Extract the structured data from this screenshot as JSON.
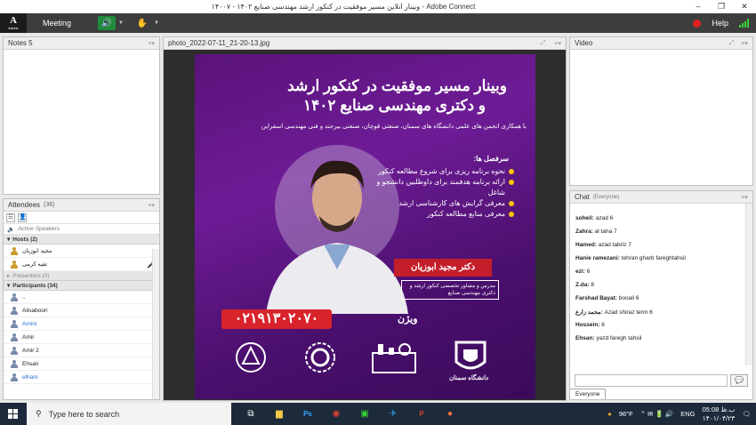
{
  "window": {
    "title": "وبینار آنلاین مسیر موفقیت در کنکور ارشد مهندسی صنایع ۱۴۰۲ - ۱۴۰۰۷ - Adobe Connect",
    "controls": [
      "–",
      "❐",
      "✕"
    ]
  },
  "menubar": {
    "logo_main": "A",
    "logo_sub": "Adobe",
    "meeting_label": "Meeting",
    "help_label": "Help",
    "colors": {
      "bg": "#3d3d3d",
      "speaker_on": "#1f8a3a",
      "record": "#e02020",
      "signal": "#37d437"
    }
  },
  "notes": {
    "title": "Notes 5"
  },
  "share": {
    "title": "photo_2022-07-11_21-20-13.jpg"
  },
  "video": {
    "title": "Video"
  },
  "attendees": {
    "title": "Attendees",
    "count": "(36)",
    "active_speakers": "Active Speakers",
    "hosts_label": "Hosts (2)",
    "hosts": [
      "مجید ابوزیان",
      "تقیه کرمی"
    ],
    "presenters_label": "Presenters (0)",
    "participants_label": "Participants (34)",
    "participants": [
      {
        "name": "..",
        "color": "#222"
      },
      {
        "name": "Alisaboori",
        "color": "#222"
      },
      {
        "name": "Amini",
        "color": "#2a6fd6"
      },
      {
        "name": "Amir",
        "color": "#222"
      },
      {
        "name": "Amir 2",
        "color": "#222"
      },
      {
        "name": "Ehsan",
        "color": "#222"
      },
      {
        "name": "elham",
        "color": "#2a6fd6"
      }
    ]
  },
  "chat": {
    "title": "Chat",
    "scope": "(Everyone)",
    "tab_label": "Everyone",
    "messages": [
      {
        "who": "soheil:",
        "text": " azad 6"
      },
      {
        "who": "Zahra:",
        "text": " al taha 7"
      },
      {
        "who": "Hamed:",
        "text": " azad tabriz 7"
      },
      {
        "who": "Hanie ramezani:",
        "text": " tehran gharb fareghtahsil"
      },
      {
        "who": "ezi:",
        "text": " 6"
      },
      {
        "who": "Z.da:",
        "text": " 8"
      },
      {
        "who": "Farshad Bayat:",
        "text": " booali 6"
      },
      {
        "who": "محمد زارع:",
        "text": " Azad shiraz term 6"
      },
      {
        "who": "Hossein:",
        "text": " 8"
      },
      {
        "who": "Ehsan:",
        "text": " yazd faregh tahsil"
      }
    ]
  },
  "poster": {
    "title_line1": "وبینار مسیر موفقیت در کنکور ارشد",
    "title_line2": "و دکتری مهندسی صنایع ۱۴۰۲",
    "subtitle": "با همکاری انجمن های علمی دانشگاه های سمنان، صنعتی قوچان، صنعتی بیرجند و فنی مهندسی اسفراین",
    "section_title": "سرفصل ها:",
    "bullets": [
      "نحوه برنامه ریزی برای شروع مطالعه کنکور",
      "ارائه برنامه هدفمند برای داوطلبین دانشجو و شاغل",
      "معرفی گرایش های کارشناسی ارشد",
      "معرفی منابع مطالعه کنکور"
    ],
    "speaker_name": "دکتر مجید ابوزیان",
    "speaker_desc": "مدرس و مشاور تخصصی کنکور ارشد و دکتری مهندسی صنایع",
    "phone": "۰۲۱۹۱۳۰۲۰۷۰",
    "brand": "ویژن",
    "logo_captions": [
      "دانشگاه سمنان",
      "",
      "",
      ""
    ],
    "colors": {
      "accent": "#ffc400",
      "phone_bg": "#d8232a",
      "name_bg": "#c41e2a"
    }
  },
  "taskbar": {
    "search_placeholder": "Type here to search",
    "weather": "96°F",
    "lang": "ENG",
    "time": "05:08 ب.ظ",
    "date": "۱۴۰۱/۰۴/۲۳"
  }
}
